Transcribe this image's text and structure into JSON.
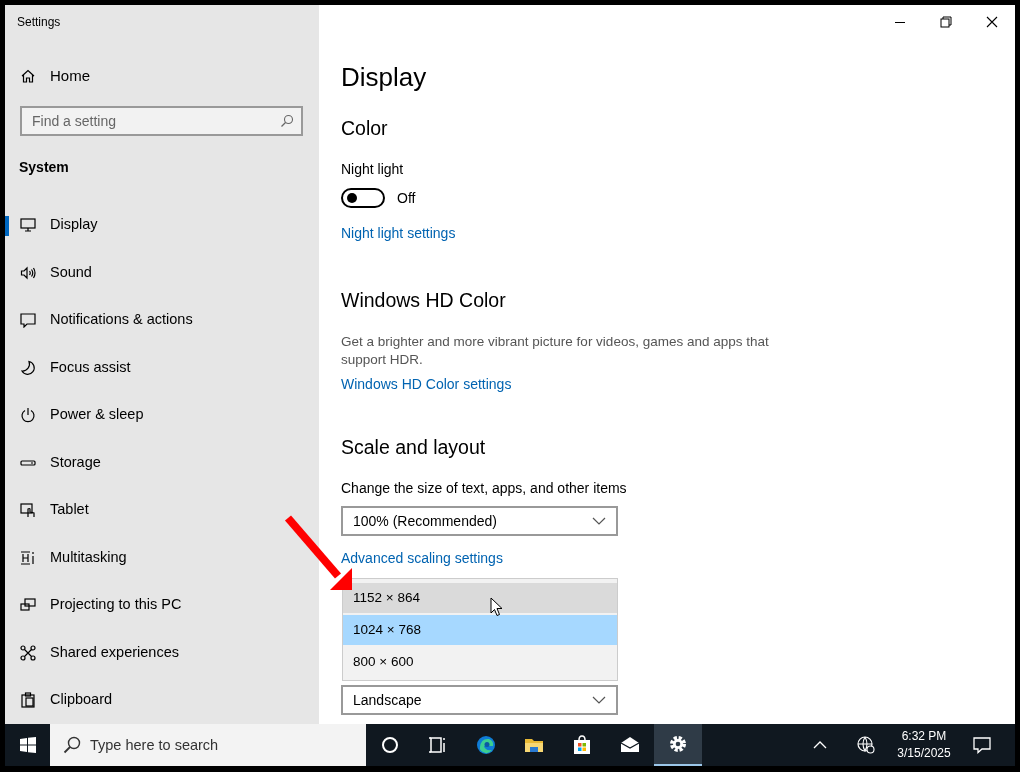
{
  "window": {
    "title": "Settings"
  },
  "sidebar": {
    "home": "Home",
    "search": {
      "placeholder": "Find a setting"
    },
    "section": "System",
    "items": [
      {
        "label": "Display",
        "selected": true
      },
      {
        "label": "Sound",
        "selected": false
      },
      {
        "label": "Notifications & actions",
        "selected": false
      },
      {
        "label": "Focus assist",
        "selected": false
      },
      {
        "label": "Power & sleep",
        "selected": false
      },
      {
        "label": "Storage",
        "selected": false
      },
      {
        "label": "Tablet",
        "selected": false
      },
      {
        "label": "Multitasking",
        "selected": false
      },
      {
        "label": "Projecting to this PC",
        "selected": false
      },
      {
        "label": "Shared experiences",
        "selected": false
      },
      {
        "label": "Clipboard",
        "selected": false
      }
    ]
  },
  "content": {
    "title": "Display",
    "color": {
      "heading": "Color",
      "night_light": {
        "label": "Night light",
        "on": false,
        "state_text": "Off"
      },
      "link": "Night light settings"
    },
    "hd_color": {
      "heading": "Windows HD Color",
      "description": "Get a brighter and more vibrant picture for videos, games and apps that support HDR.",
      "link": "Windows HD Color settings"
    },
    "scale": {
      "heading": "Scale and layout",
      "size_label": "Change the size of text, apps, and other items",
      "size_value": "100% (Recommended)",
      "link": "Advanced scaling settings",
      "resolution_options": [
        {
          "label": "1152 × 864",
          "selected": false,
          "hovered": true
        },
        {
          "label": "1024 × 768",
          "selected": true,
          "hovered": false
        },
        {
          "label": "800 × 600",
          "selected": false,
          "hovered": false
        }
      ],
      "orientation_value": "Landscape"
    }
  },
  "taskbar": {
    "search": {
      "placeholder": "Type here to search"
    },
    "apps": [
      {
        "active": false
      },
      {
        "active": false
      },
      {
        "active": false
      },
      {
        "active": false
      },
      {
        "active": false
      },
      {
        "active": false
      },
      {
        "active": true
      }
    ],
    "time": "6:32 PM",
    "date": "3/15/2025"
  }
}
